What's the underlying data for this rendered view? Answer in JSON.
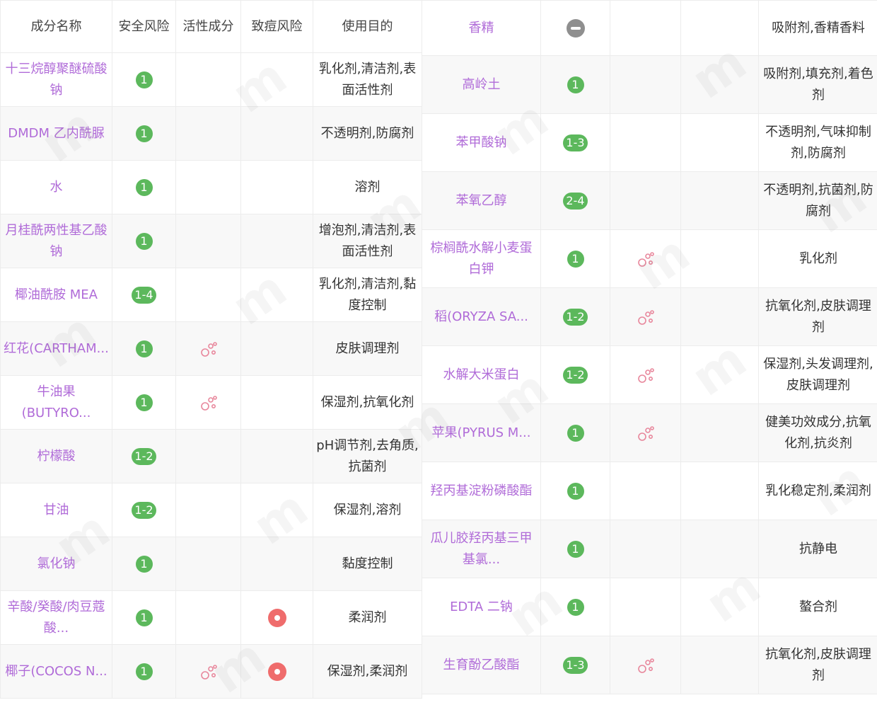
{
  "headers": {
    "name": "成分名称",
    "safety": "安全风险",
    "active": "活性成分",
    "acne": "致痘风险",
    "purpose": "使用目的"
  },
  "colors": {
    "name_text": "#b06bd8",
    "safety_badge": "#5cb85c",
    "acne_icon": "#ef6c6c",
    "active_icon": "#e8879c",
    "neutral_icon": "#8f8f8f"
  },
  "icons": {
    "active": "active-ingredient-icon",
    "acne": "acne-risk-icon",
    "unknown_safety": "minus-circle-icon"
  },
  "left_rows": [
    {
      "name": "十三烷醇聚醚硫酸钠",
      "safety": "1",
      "active": false,
      "acne": false,
      "purpose": "乳化剂,清洁剂,表面活性剂"
    },
    {
      "name": "DMDM 乙内酰脲",
      "safety": "1",
      "active": false,
      "acne": false,
      "purpose": "不透明剂,防腐剂"
    },
    {
      "name": "水",
      "safety": "1",
      "active": false,
      "acne": false,
      "purpose": "溶剂"
    },
    {
      "name": "月桂酰两性基乙酸钠",
      "safety": "1",
      "active": false,
      "acne": false,
      "purpose": "增泡剂,清洁剂,表面活性剂"
    },
    {
      "name": "椰油酰胺 MEA",
      "safety": "1-4",
      "active": false,
      "acne": false,
      "purpose": "乳化剂,清洁剂,黏度控制"
    },
    {
      "name": "红花(CARTHAM...",
      "safety": "1",
      "active": true,
      "acne": false,
      "purpose": "皮肤调理剂"
    },
    {
      "name": "牛油果(BUTYRO...",
      "safety": "1",
      "active": true,
      "acne": false,
      "purpose": "保湿剂,抗氧化剂"
    },
    {
      "name": "柠檬酸",
      "safety": "1-2",
      "active": false,
      "acne": false,
      "purpose": "pH调节剂,去角质,抗菌剂"
    },
    {
      "name": "甘油",
      "safety": "1-2",
      "active": false,
      "acne": false,
      "purpose": "保湿剂,溶剂"
    },
    {
      "name": "氯化钠",
      "safety": "1",
      "active": false,
      "acne": false,
      "purpose": "黏度控制"
    },
    {
      "name": "辛酸/癸酸/肉豆蔻酸...",
      "safety": "1",
      "active": false,
      "acne": true,
      "purpose": "柔润剂"
    },
    {
      "name": "椰子(COCOS N...",
      "safety": "1",
      "active": true,
      "acne": true,
      "purpose": "保湿剂,柔润剂"
    }
  ],
  "right_rows": [
    {
      "name": "香精",
      "safety": "",
      "active": false,
      "acne": false,
      "purpose": "吸附剂,香精香料"
    },
    {
      "name": "高岭土",
      "safety": "1",
      "active": false,
      "acne": false,
      "purpose": "吸附剂,填充剂,着色剂"
    },
    {
      "name": "苯甲酸钠",
      "safety": "1-3",
      "active": false,
      "acne": false,
      "purpose": "不透明剂,气味抑制剂,防腐剂"
    },
    {
      "name": "苯氧乙醇",
      "safety": "2-4",
      "active": false,
      "acne": false,
      "purpose": "不透明剂,抗菌剂,防腐剂"
    },
    {
      "name": "棕榈酰水解小麦蛋白钾",
      "safety": "1",
      "active": true,
      "acne": false,
      "purpose": "乳化剂"
    },
    {
      "name": "稻(ORYZA SA...",
      "safety": "1-2",
      "active": true,
      "acne": false,
      "purpose": "抗氧化剂,皮肤调理剂"
    },
    {
      "name": "水解大米蛋白",
      "safety": "1-2",
      "active": true,
      "acne": false,
      "purpose": "保湿剂,头发调理剂,皮肤调理剂"
    },
    {
      "name": "苹果(PYRUS M...",
      "safety": "1",
      "active": true,
      "acne": false,
      "purpose": "健美功效成分,抗氧化剂,抗炎剂"
    },
    {
      "name": "羟丙基淀粉磷酸酯",
      "safety": "1",
      "active": false,
      "acne": false,
      "purpose": "乳化稳定剂,柔润剂"
    },
    {
      "name": "瓜儿胶羟丙基三甲基氯...",
      "safety": "1",
      "active": false,
      "acne": false,
      "purpose": "抗静电"
    },
    {
      "name": "EDTA 二钠",
      "safety": "1",
      "active": false,
      "acne": false,
      "purpose": "螯合剂"
    },
    {
      "name": "生育酚乙酸酯",
      "safety": "1-3",
      "active": true,
      "acne": false,
      "purpose": "抗氧化剂,皮肤调理剂"
    }
  ]
}
